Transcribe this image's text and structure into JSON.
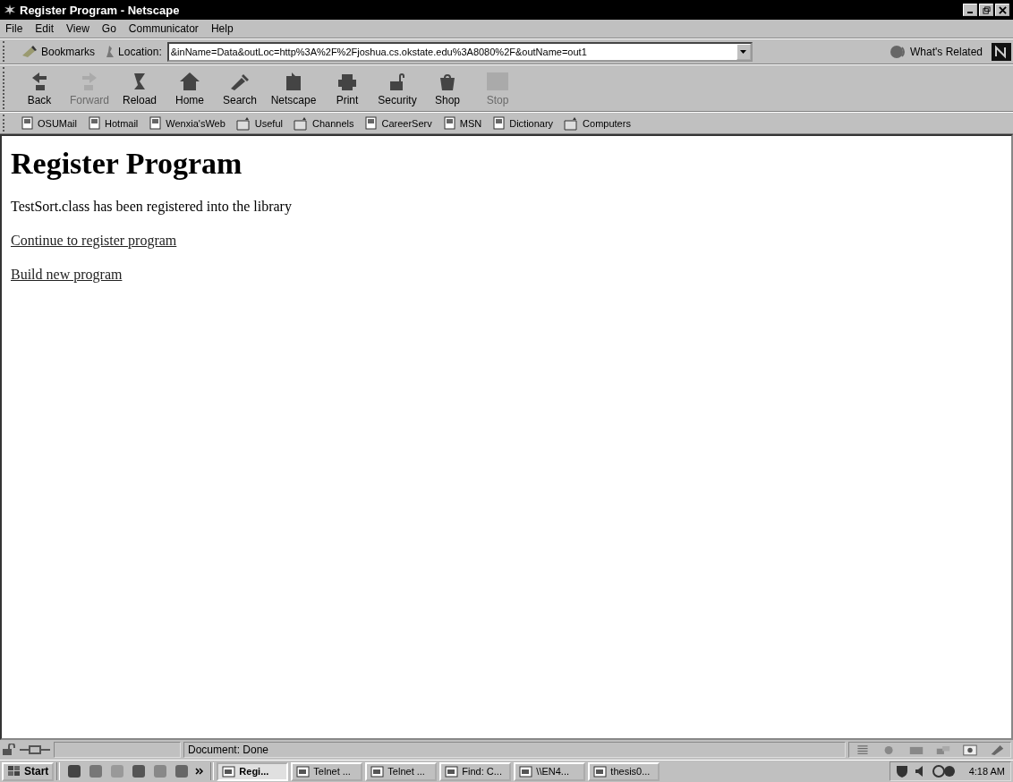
{
  "window": {
    "title": "Register Program - Netscape"
  },
  "menu": [
    "File",
    "Edit",
    "View",
    "Go",
    "Communicator",
    "Help"
  ],
  "location_bar": {
    "bookmarks": "Bookmarks",
    "label": "Location:",
    "url": "&inName=Data&outLoc=http%3A%2F%2Fjoshua.cs.okstate.edu%3A8080%2F&outName=out1",
    "related": "What's Related"
  },
  "toolbar": [
    {
      "label": "Back",
      "disabled": false
    },
    {
      "label": "Forward",
      "disabled": true
    },
    {
      "label": "Reload",
      "disabled": false
    },
    {
      "label": "Home",
      "disabled": false
    },
    {
      "label": "Search",
      "disabled": false
    },
    {
      "label": "Netscape",
      "disabled": false
    },
    {
      "label": "Print",
      "disabled": false
    },
    {
      "label": "Security",
      "disabled": false
    },
    {
      "label": "Shop",
      "disabled": false
    },
    {
      "label": "Stop",
      "disabled": true
    }
  ],
  "personal_toolbar": [
    {
      "label": "OSUMail",
      "kind": "page"
    },
    {
      "label": "Hotmail",
      "kind": "page"
    },
    {
      "label": "Wenxia'sWeb",
      "kind": "page"
    },
    {
      "label": "Useful",
      "kind": "folder"
    },
    {
      "label": "Channels",
      "kind": "folder"
    },
    {
      "label": "CareerServ",
      "kind": "page"
    },
    {
      "label": "MSN",
      "kind": "page"
    },
    {
      "label": "Dictionary",
      "kind": "page"
    },
    {
      "label": "Computers",
      "kind": "folder"
    }
  ],
  "page": {
    "heading": "Register Program",
    "message": "TestSort.class has been registered into the library",
    "links": [
      "Continue to register program",
      "Build new program"
    ]
  },
  "status_bar": {
    "text": "Document: Done"
  },
  "taskbar": {
    "start": "Start",
    "tasks": [
      {
        "label": "Regi...",
        "selected": true
      },
      {
        "label": "Telnet ...",
        "selected": false
      },
      {
        "label": "Telnet ...",
        "selected": false
      },
      {
        "label": "Find: C...",
        "selected": false
      },
      {
        "label": "\\\\EN4...",
        "selected": false
      },
      {
        "label": "thesis0...",
        "selected": false
      }
    ],
    "clock": "4:18 AM"
  }
}
